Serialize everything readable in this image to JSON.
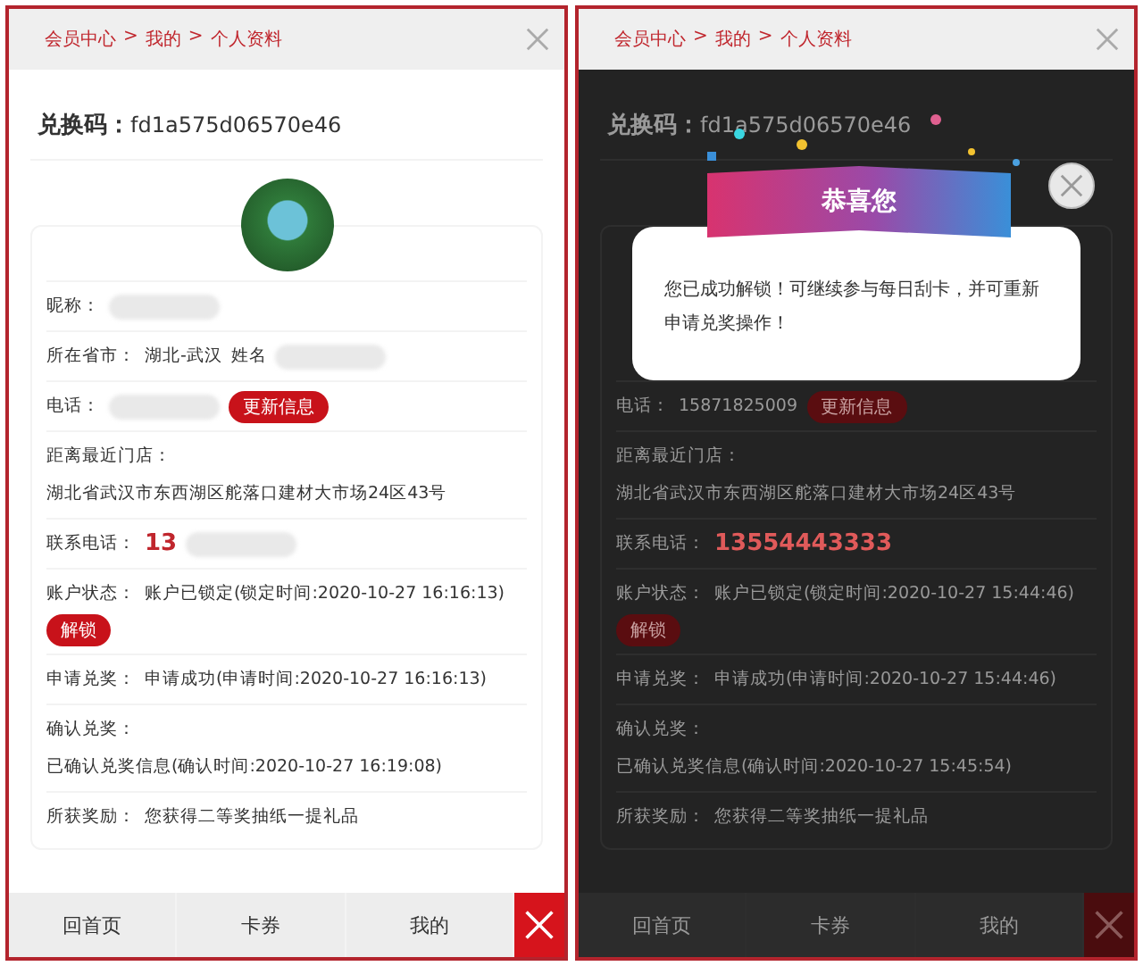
{
  "panels": [
    {
      "breadcrumb": {
        "items": [
          "会员中心",
          "我的",
          "个人资料"
        ],
        "separator": ">"
      },
      "code_label": "兑换码：",
      "code": "fd1a575d06570e46",
      "dimmed": false,
      "rows": [
        {
          "kind": "field",
          "parts": [
            {
              "kind": "label",
              "text": "昵称："
            },
            {
              "kind": "redacted"
            }
          ]
        },
        {
          "kind": "field",
          "parts": [
            {
              "kind": "label",
              "text": "所在省市："
            },
            {
              "kind": "text",
              "text": "湖北-武汉"
            },
            {
              "kind": "text",
              "text": "姓名"
            },
            {
              "kind": "redacted"
            }
          ]
        },
        {
          "kind": "field",
          "parts": [
            {
              "kind": "label",
              "text": "电话："
            },
            {
              "kind": "redacted"
            },
            {
              "kind": "button",
              "text": "更新信息"
            }
          ]
        },
        {
          "kind": "field",
          "parts": [
            {
              "kind": "label",
              "text": "距离最近门店："
            },
            {
              "kind": "text",
              "text": "湖北省武汉市东西湖区舵落口建材大市场24区43号"
            }
          ]
        },
        {
          "kind": "field",
          "parts": [
            {
              "kind": "label",
              "text": "联系电话："
            },
            {
              "kind": "emph",
              "text": "13"
            },
            {
              "kind": "redacted"
            }
          ]
        },
        {
          "kind": "field",
          "parts": [
            {
              "kind": "label",
              "text": "账户状态："
            },
            {
              "kind": "text",
              "text": "账户已锁定(锁定时间:2020-10-27 16:16:13)"
            },
            {
              "kind": "button",
              "text": "解锁"
            }
          ]
        },
        {
          "kind": "field",
          "parts": [
            {
              "kind": "label",
              "text": "申请兑奖："
            },
            {
              "kind": "text",
              "text": "申请成功(申请时间:2020-10-27 16:16:13)"
            }
          ]
        },
        {
          "kind": "field",
          "parts": [
            {
              "kind": "label",
              "text": "确认兑奖："
            },
            {
              "kind": "text",
              "text": "已确认兑奖信息(确认时间:2020-10-27 16:19:08)"
            }
          ]
        },
        {
          "kind": "field",
          "parts": [
            {
              "kind": "label",
              "text": "所获奖励："
            },
            {
              "kind": "text",
              "text": "您获得二等奖抽纸一提礼品"
            }
          ]
        }
      ],
      "nav": [
        "回首页",
        "卡券",
        "我的"
      ]
    },
    {
      "breadcrumb": {
        "items": [
          "会员中心",
          "我的",
          "个人资料"
        ],
        "separator": ">"
      },
      "code_label": "兑换码：",
      "code": "fd1a575d06570e46",
      "dimmed": true,
      "rows": [
        {
          "kind": "covered"
        },
        {
          "kind": "covered"
        },
        {
          "kind": "field",
          "parts": [
            {
              "kind": "label",
              "text": "电话："
            },
            {
              "kind": "text",
              "text": "15871825009"
            },
            {
              "kind": "button",
              "text": "更新信息"
            }
          ]
        },
        {
          "kind": "field",
          "parts": [
            {
              "kind": "label",
              "text": "距离最近门店："
            },
            {
              "kind": "text",
              "text": "湖北省武汉市东西湖区舵落口建材大市场24区43号"
            }
          ]
        },
        {
          "kind": "field",
          "parts": [
            {
              "kind": "label",
              "text": "联系电话："
            },
            {
              "kind": "emph",
              "text": "13554443333"
            }
          ]
        },
        {
          "kind": "field",
          "parts": [
            {
              "kind": "label",
              "text": "账户状态："
            },
            {
              "kind": "text",
              "text": "账户已锁定(锁定时间:2020-10-27 15:44:46)"
            },
            {
              "kind": "button",
              "text": "解锁"
            }
          ]
        },
        {
          "kind": "field",
          "parts": [
            {
              "kind": "label",
              "text": "申请兑奖："
            },
            {
              "kind": "text",
              "text": "申请成功(申请时间:2020-10-27 15:44:46)"
            }
          ]
        },
        {
          "kind": "field",
          "parts": [
            {
              "kind": "label",
              "text": "确认兑奖："
            },
            {
              "kind": "text",
              "text": "已确认兑奖信息(确认时间:2020-10-27 15:45:54)"
            }
          ]
        },
        {
          "kind": "field",
          "parts": [
            {
              "kind": "label",
              "text": "所获奖励："
            },
            {
              "kind": "text",
              "text": "您获得二等奖抽纸一提礼品"
            }
          ]
        }
      ],
      "modal": {
        "title": "恭喜您",
        "message": "您已成功解锁！可继续参与每日刮卡，并可重新申请兑奖操作！"
      },
      "nav": [
        "回首页",
        "卡券",
        "我的"
      ]
    }
  ]
}
